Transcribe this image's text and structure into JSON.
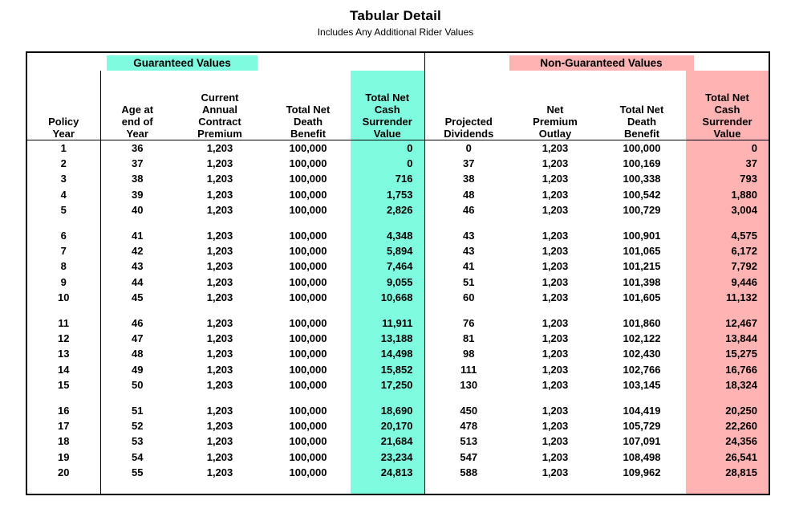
{
  "title": "Tabular Detail",
  "subtitle": "Includes Any Additional Rider Values",
  "colors": {
    "guaranteed_highlight": "#7FFBE0",
    "nonguaranteed_highlight": "#FFB3B3",
    "border": "#000000",
    "text": "#000000"
  },
  "groups": {
    "guaranteed": "Guaranteed Values",
    "non_guaranteed": "Non-Guaranteed Values"
  },
  "headers": {
    "policy_year": [
      "Policy",
      "Year"
    ],
    "age_end_year": [
      "Age at",
      "end of",
      "Year"
    ],
    "current_annual_contract_premium": [
      "Current",
      "Annual",
      "Contract",
      "Premium"
    ],
    "total_net_death_benefit_g": [
      "Total Net",
      "Death",
      "Benefit"
    ],
    "total_net_cash_surrender_value_g": [
      "Total Net",
      "Cash",
      "Surrender",
      "Value"
    ],
    "projected_dividends": [
      "Projected",
      "Dividends"
    ],
    "net_premium_outlay": [
      "Net",
      "Premium",
      "Outlay"
    ],
    "total_net_death_benefit_ng": [
      "Total Net",
      "Death",
      "Benefit"
    ],
    "total_net_cash_surrender_value_ng": [
      "Total Net",
      "Cash",
      "Surrender",
      "Value"
    ]
  },
  "chart_data": {
    "type": "table",
    "title": "Tabular Detail",
    "subtitle": "Includes Any Additional Rider Values",
    "column_groups": [
      {
        "label": "",
        "columns": [
          "Policy Year"
        ]
      },
      {
        "label": "Guaranteed Values",
        "columns": [
          "Age at end of Year",
          "Current Annual Contract Premium",
          "Total Net Death Benefit",
          "Total Net Cash Surrender Value"
        ]
      },
      {
        "label": "Non-Guaranteed Values",
        "columns": [
          "Projected Dividends",
          "Net Premium Outlay",
          "Total Net Death Benefit",
          "Total Net Cash Surrender Value"
        ]
      }
    ],
    "columns": [
      "Policy Year",
      "Age at end of Year",
      "Current Annual Contract Premium",
      "Total Net Death Benefit",
      "Total Net Cash Surrender Value",
      "Projected Dividends",
      "Net Premium Outlay",
      "Total Net Death Benefit",
      "Total Net Cash Surrender Value"
    ],
    "rows": [
      [
        "1",
        "36",
        "1,203",
        "100,000",
        "0",
        "0",
        "1,203",
        "100,000",
        "0"
      ],
      [
        "2",
        "37",
        "1,203",
        "100,000",
        "0",
        "37",
        "1,203",
        "100,169",
        "37"
      ],
      [
        "3",
        "38",
        "1,203",
        "100,000",
        "716",
        "38",
        "1,203",
        "100,338",
        "793"
      ],
      [
        "4",
        "39",
        "1,203",
        "100,000",
        "1,753",
        "48",
        "1,203",
        "100,542",
        "1,880"
      ],
      [
        "5",
        "40",
        "1,203",
        "100,000",
        "2,826",
        "46",
        "1,203",
        "100,729",
        "3,004"
      ],
      [
        "6",
        "41",
        "1,203",
        "100,000",
        "4,348",
        "43",
        "1,203",
        "100,901",
        "4,575"
      ],
      [
        "7",
        "42",
        "1,203",
        "100,000",
        "5,894",
        "43",
        "1,203",
        "101,065",
        "6,172"
      ],
      [
        "8",
        "43",
        "1,203",
        "100,000",
        "7,464",
        "41",
        "1,203",
        "101,215",
        "7,792"
      ],
      [
        "9",
        "44",
        "1,203",
        "100,000",
        "9,055",
        "51",
        "1,203",
        "101,398",
        "9,446"
      ],
      [
        "10",
        "45",
        "1,203",
        "100,000",
        "10,668",
        "60",
        "1,203",
        "101,605",
        "11,132"
      ],
      [
        "11",
        "46",
        "1,203",
        "100,000",
        "11,911",
        "76",
        "1,203",
        "101,860",
        "12,467"
      ],
      [
        "12",
        "47",
        "1,203",
        "100,000",
        "13,188",
        "81",
        "1,203",
        "102,122",
        "13,844"
      ],
      [
        "13",
        "48",
        "1,203",
        "100,000",
        "14,498",
        "98",
        "1,203",
        "102,430",
        "15,275"
      ],
      [
        "14",
        "49",
        "1,203",
        "100,000",
        "15,852",
        "111",
        "1,203",
        "102,766",
        "16,766"
      ],
      [
        "15",
        "50",
        "1,203",
        "100,000",
        "17,250",
        "130",
        "1,203",
        "103,145",
        "18,324"
      ],
      [
        "16",
        "51",
        "1,203",
        "100,000",
        "18,690",
        "450",
        "1,203",
        "104,419",
        "20,250"
      ],
      [
        "17",
        "52",
        "1,203",
        "100,000",
        "20,170",
        "478",
        "1,203",
        "105,729",
        "22,260"
      ],
      [
        "18",
        "53",
        "1,203",
        "100,000",
        "21,684",
        "513",
        "1,203",
        "107,091",
        "24,356"
      ],
      [
        "19",
        "54",
        "1,203",
        "100,000",
        "23,234",
        "547",
        "1,203",
        "108,498",
        "26,541"
      ],
      [
        "20",
        "55",
        "1,203",
        "100,000",
        "24,813",
        "588",
        "1,203",
        "109,962",
        "28,815"
      ]
    ],
    "group_breaks_after_rows": [
      5,
      10,
      15
    ]
  }
}
